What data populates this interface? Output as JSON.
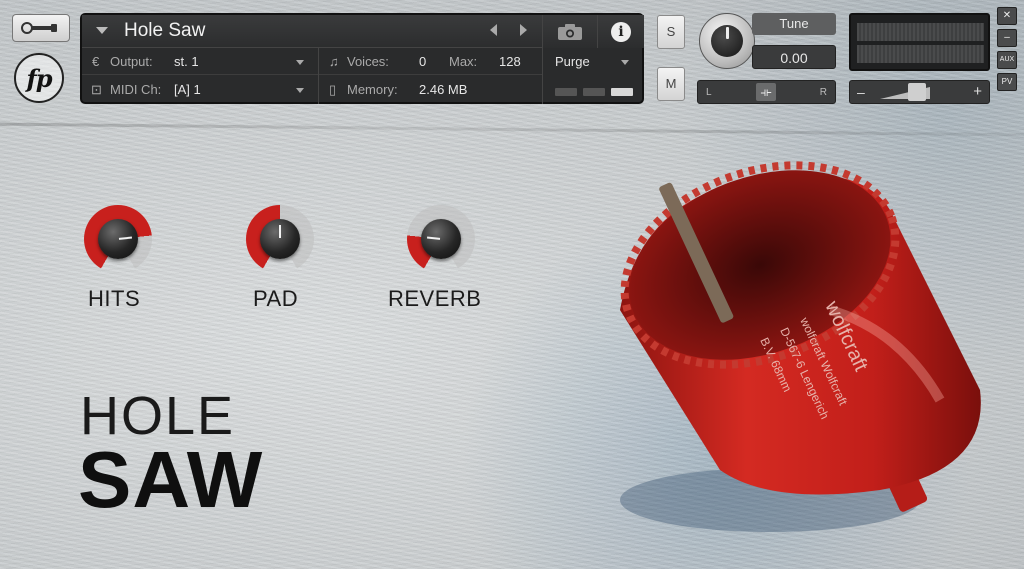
{
  "window": {
    "title": "Hole Saw",
    "output_label": "Output:",
    "output_value": "st. 1",
    "voices_label": "Voices:",
    "voices_value": "0",
    "max_label": "Max:",
    "max_value": "128",
    "midi_label": "MIDI Ch:",
    "midi_value": "[A]  1",
    "memory_label": "Memory:",
    "memory_value": "2.46 MB",
    "purge_label": "Purge"
  },
  "controls": {
    "solo_label": "S",
    "mute_label": "M",
    "tune_label": "Tune",
    "tune_value": "0.00",
    "pan_left": "L",
    "pan_right": "R",
    "side_close": "✕",
    "side_min": "–",
    "side_aux": "AUX",
    "side_pv": "PV"
  },
  "instrument": {
    "knobs": [
      {
        "label": "HITS",
        "level": 0.78
      },
      {
        "label": "PAD",
        "level": 0.5
      },
      {
        "label": "REVERB",
        "level": 0.22
      }
    ],
    "brand_line1": "HOLE",
    "brand_line2": "SAW",
    "logo_text": "fp",
    "saw_printed_text": [
      "wolfcraft",
      "wolfcraft Wolfcraft",
      "D-567-6 Lengerich",
      "B.V. 68mm"
    ]
  },
  "colors": {
    "accent_red": "#c8201d",
    "panel_dark": "#2a2b2c"
  }
}
